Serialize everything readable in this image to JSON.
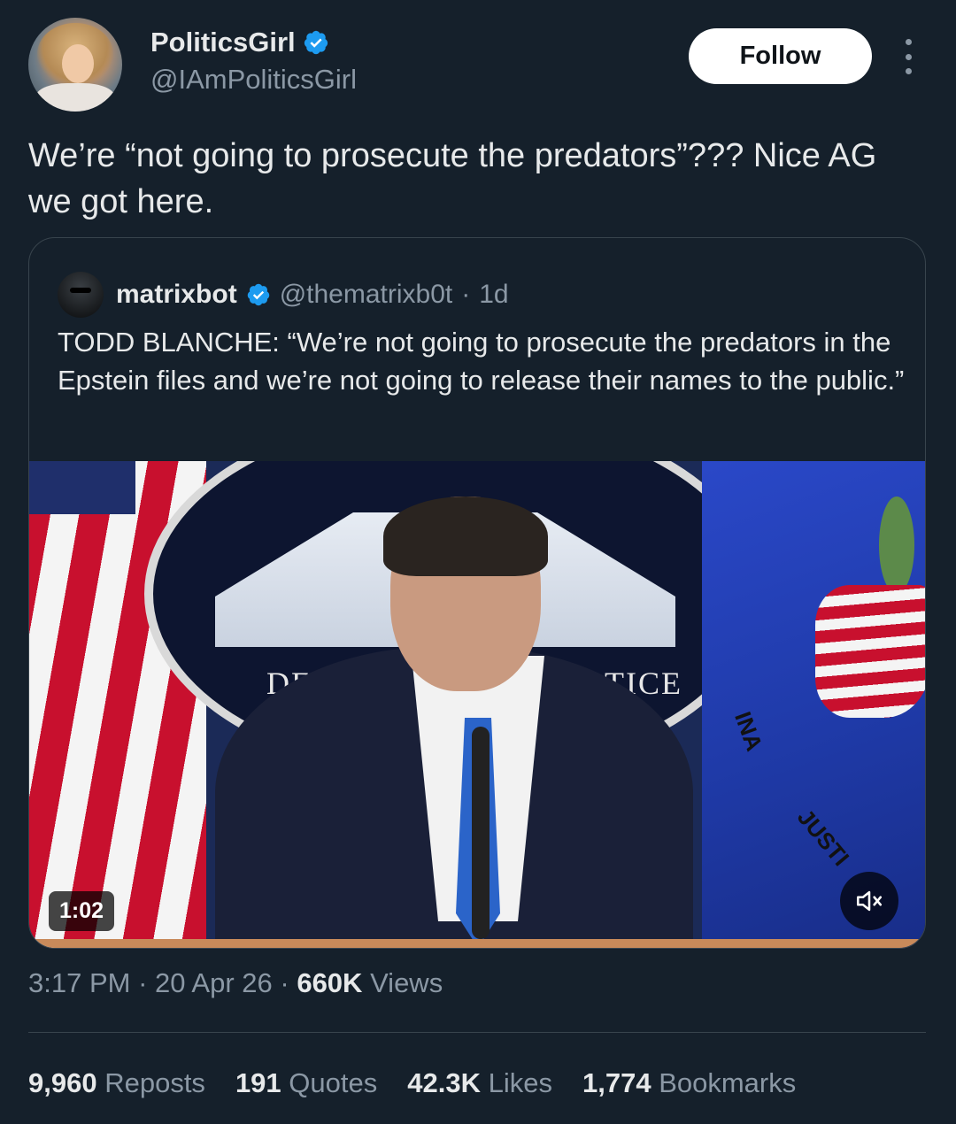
{
  "author": {
    "display_name": "PoliticsGirl",
    "handle": "@IAmPoliticsGirl",
    "verified": true,
    "avatar_icon": "profile-photo"
  },
  "follow_button": {
    "label": "Follow"
  },
  "more_icon": "more-options-icon",
  "tweet": {
    "text": "We’re “not going to prosecute the predators”??? Nice AG we got here."
  },
  "quoted_tweet": {
    "display_name": "matrixbot",
    "handle": "@thematrixb0t",
    "separator": "·",
    "age": "1d",
    "verified": true,
    "text": "TODD BLANCHE: “We’re not going to prosecute the predators in the Epstein files and we’re not going to release their names to the public.”",
    "video": {
      "duration": "1:02",
      "seal_text_left": "DEPA",
      "seal_text_right": "TICE",
      "banner_text_1": "INA",
      "banner_text_2": "JUSTI",
      "muted": true
    }
  },
  "meta": {
    "time": "3:17 PM",
    "sep1": "·",
    "date": "20 Apr 26",
    "sep2": "·",
    "views_count": "660K",
    "views_label": "Views"
  },
  "stats": [
    {
      "count": "9,960",
      "label": "Reposts"
    },
    {
      "count": "191",
      "label": "Quotes"
    },
    {
      "count": "42.3K",
      "label": "Likes"
    },
    {
      "count": "1,774",
      "label": "Bookmarks"
    }
  ],
  "colors": {
    "background": "#15202b",
    "text_primary": "#e7e9ea",
    "text_secondary": "#8b98a5",
    "verified_blue": "#1d9bf0",
    "border": "#38444d"
  }
}
